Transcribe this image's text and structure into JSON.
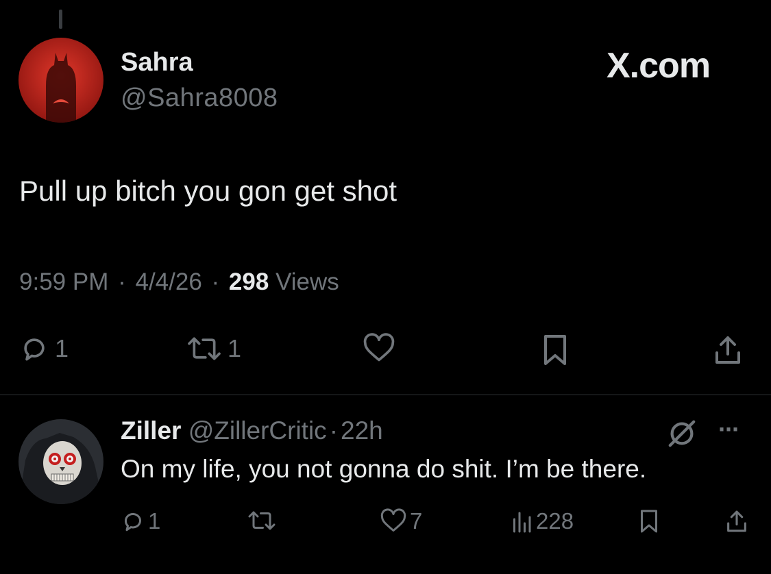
{
  "brand": "X.com",
  "colors": {
    "background": "#000000",
    "text": "#e7e9ea",
    "muted": "#71767b",
    "divider": "#2f3336",
    "avatar_red": "#c8281c"
  },
  "tweet": {
    "author_name": "Sahra",
    "author_handle": "@Sahra8008",
    "text": "Pull up bitch you gon get shot",
    "time": "9:59 PM",
    "date": "4/4/26",
    "views_count": "298",
    "views_label": "Views",
    "sep": "·",
    "actions": {
      "reply_count": "1",
      "repost_count": "1"
    }
  },
  "reply": {
    "author_name": "Ziller",
    "author_handle": "@ZillerCritic",
    "sep": "·",
    "age": "22h",
    "text": "On my life, you not gonna do shit. I’m be there.",
    "more": "···",
    "actions": {
      "reply_count": "1",
      "like_count": "7",
      "views_count": "228"
    }
  }
}
